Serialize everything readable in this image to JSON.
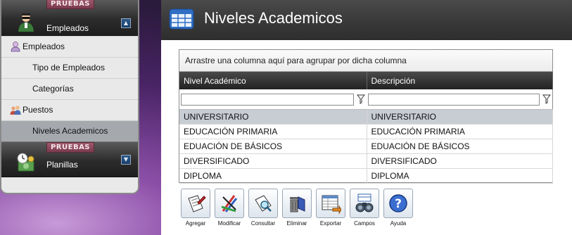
{
  "sidebar": {
    "groups": [
      {
        "badge": "PRUEBAS",
        "title": "Empleados",
        "collapse_glyph": "▲",
        "icon": "employee-group-icon",
        "items": [
          {
            "label": "Empleados",
            "icon": "person-icon",
            "active": false
          },
          {
            "label": "Tipo de Empleados",
            "icon": null,
            "active": false
          },
          {
            "label": "Categorías",
            "icon": null,
            "active": false
          },
          {
            "label": "Puestos",
            "icon": "people-icon",
            "active": false
          },
          {
            "label": "Niveles Academicos",
            "icon": null,
            "active": true
          }
        ]
      },
      {
        "badge": "PRUEBAS",
        "title": "Planillas",
        "collapse_glyph": "▼",
        "icon": "payroll-icon",
        "items": []
      }
    ]
  },
  "main": {
    "title": "Niveles Academicos",
    "title_icon": "table-icon",
    "grid": {
      "group_panel_text": "Arrastre una columna aquí para agrupar por dicha columna",
      "columns": [
        "Nivel Académico",
        "Descripción"
      ],
      "rows": [
        [
          "UNIVERSITARIO",
          "UNIVERSITARIO"
        ],
        [
          "EDUCACIÓN PRIMARIA",
          "EDUCACIÓN PRIMARIA"
        ],
        [
          "EDUACIÓN DE BÁSICOS",
          "EDUACIÓN DE BÁSICOS"
        ],
        [
          "DIVERSIFICADO",
          "DIVERSIFICADO"
        ],
        [
          "DIPLOMA",
          "DIPLOMA"
        ]
      ],
      "selected_row": 0
    },
    "toolbar": [
      {
        "label": "Agregar",
        "icon": "add-document-icon"
      },
      {
        "label": "Modificar",
        "icon": "edit-pencils-icon"
      },
      {
        "label": "Consultar",
        "icon": "search-document-icon"
      },
      {
        "label": "Eliminar",
        "icon": "trash-icon"
      },
      {
        "label": "Exportar",
        "icon": "export-spreadsheet-icon"
      },
      {
        "label": "Campos",
        "icon": "binoculars-icon"
      },
      {
        "label": "Ayuda",
        "icon": "help-icon"
      }
    ]
  },
  "colors": {
    "header_dark": "#2e2e2e",
    "badge": "#7a3a4e",
    "selected_row": "#c8ccd3",
    "active_menu": "#a5a9ae"
  }
}
